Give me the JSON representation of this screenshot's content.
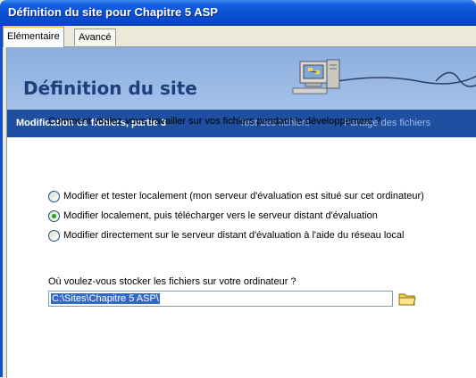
{
  "window": {
    "title": "Définition du site pour Chapitre 5 ASP"
  },
  "tabs": [
    {
      "label": "Elémentaire",
      "active": true
    },
    {
      "label": "Avancé",
      "active": false
    }
  ],
  "banner": {
    "heading": "Définition du site"
  },
  "steps": [
    {
      "label": "Modification de fichiers, partie 3",
      "active": true
    },
    {
      "label": "Test des fichiers",
      "active": false
    },
    {
      "label": "Partage des fichiers",
      "active": false
    }
  ],
  "question": "Comment voulez-vous travailler sur vos fichiers pendant le développement ?",
  "options": [
    {
      "label": "Modifier et tester localement (mon serveur d'évaluation est situé sur cet ordinateur)",
      "selected": false
    },
    {
      "label": "Modifier localement, puis télécharger vers le serveur distant d'évaluation",
      "selected": true
    },
    {
      "label": "Modifier directement sur le serveur distant d'évaluation à l'aide du réseau local",
      "selected": false
    }
  ],
  "storage": {
    "question": "Où voulez-vous stocker les fichiers sur votre ordinateur ?",
    "path": "C:\\Sites\\Chapitre 5 ASP\\"
  },
  "icons": {
    "browse": "folder-icon",
    "banner_art": "computer-network-icon"
  },
  "colors": {
    "titlebar": "#0a4fd3",
    "stepbar": "#1e4fa0",
    "radio_dot": "#21a121",
    "selection": "#316ac5"
  }
}
